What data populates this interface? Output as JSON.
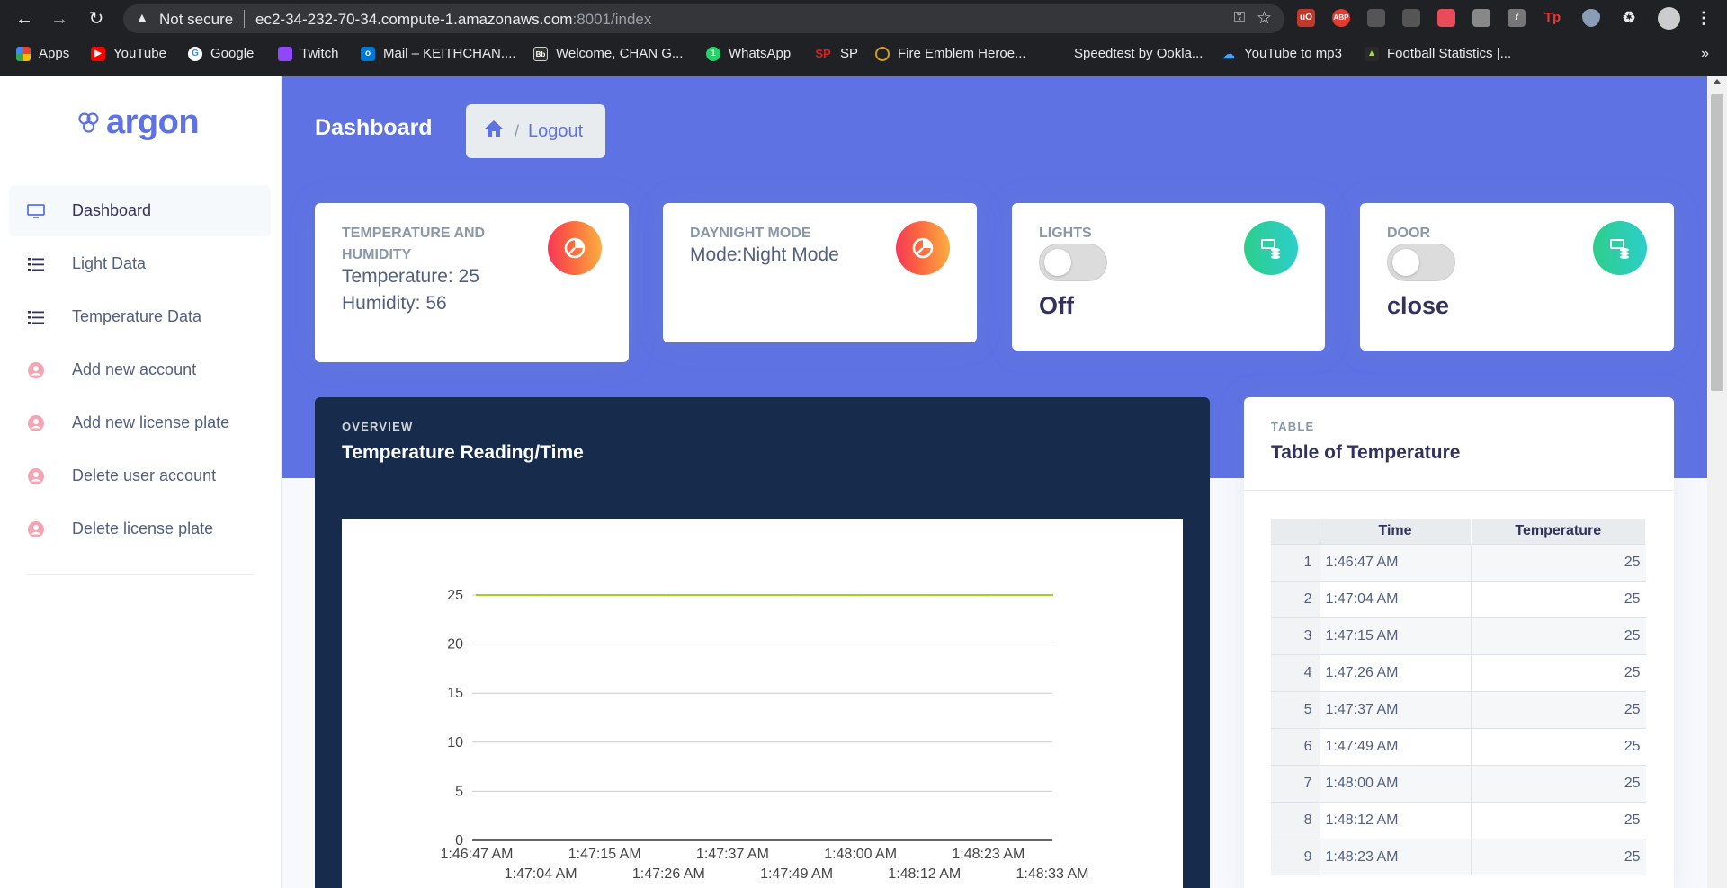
{
  "browser": {
    "security_label": "Not secure",
    "url_host": "ec2-34-232-70-34.compute-1.amazonaws.com",
    "url_path": ":8001/index",
    "bookmarks": [
      {
        "label": "Apps",
        "icon": "apps-grid-icon"
      },
      {
        "label": "YouTube",
        "icon": "youtube-icon"
      },
      {
        "label": "Google",
        "icon": "google-icon"
      },
      {
        "label": "Twitch",
        "icon": "twitch-icon"
      },
      {
        "label": "Mail – KEITHCHAN....",
        "icon": "outlook-icon"
      },
      {
        "label": "Welcome, CHAN G...",
        "icon": "blackboard-icon"
      },
      {
        "label": "WhatsApp",
        "icon": "whatsapp-icon"
      },
      {
        "label": "SP",
        "icon": "sp-icon"
      },
      {
        "label": "Fire Emblem Heroe...",
        "icon": "fire-emblem-icon"
      },
      {
        "label": "Speedtest by Ookla...",
        "icon": "speedtest-icon"
      },
      {
        "label": "YouTube to mp3",
        "icon": "download-cloud-icon"
      },
      {
        "label": "Football Statistics |...",
        "icon": "football-stats-icon"
      }
    ],
    "more_label": "»"
  },
  "brand": {
    "name": "argon"
  },
  "sidebar": {
    "items": [
      {
        "label": "Dashboard",
        "icon": "monitor-icon",
        "active": true
      },
      {
        "label": "Light Data",
        "icon": "list-icon"
      },
      {
        "label": "Temperature Data",
        "icon": "list-icon"
      },
      {
        "label": "Add new account",
        "icon": "user-circle-icon"
      },
      {
        "label": "Add new license plate",
        "icon": "user-circle-icon"
      },
      {
        "label": "Delete user account",
        "icon": "user-circle-icon"
      },
      {
        "label": "Delete license plate",
        "icon": "user-circle-icon"
      }
    ]
  },
  "header": {
    "title": "Dashboard",
    "breadcrumb_sep": "/",
    "breadcrumb_link": "Logout"
  },
  "cards": {
    "temp_humidity": {
      "label": "TEMPERATURE AND HUMIDITY",
      "temperature": "Temperature: 25",
      "humidity": "Humidity: 56",
      "icon": "pie-chart-icon"
    },
    "daynight": {
      "label": "DAYNIGHT MODE",
      "mode": "Mode:Night Mode",
      "icon": "pie-chart-icon"
    },
    "lights": {
      "label": "LIGHTS",
      "state": "Off",
      "toggle_on": false,
      "icon": "money-stack-icon"
    },
    "door": {
      "label": "DOOR",
      "state": "close",
      "toggle_on": false,
      "icon": "money-stack-icon"
    }
  },
  "overview": {
    "subtitle": "OVERVIEW",
    "title": "Temperature Reading/Time"
  },
  "table_card": {
    "subtitle": "TABLE",
    "title": "Table of Temperature",
    "columns": [
      "",
      "Time",
      "Temperature"
    ],
    "rows": [
      [
        "1",
        "1:46:47 AM",
        "25"
      ],
      [
        "2",
        "1:47:04 AM",
        "25"
      ],
      [
        "3",
        "1:47:15 AM",
        "25"
      ],
      [
        "4",
        "1:47:26 AM",
        "25"
      ],
      [
        "5",
        "1:47:37 AM",
        "25"
      ],
      [
        "6",
        "1:47:49 AM",
        "25"
      ],
      [
        "7",
        "1:48:00 AM",
        "25"
      ],
      [
        "8",
        "1:48:12 AM",
        "25"
      ],
      [
        "9",
        "1:48:23 AM",
        "25"
      ]
    ]
  },
  "chart_data": {
    "type": "line",
    "title": "",
    "xlabel": "",
    "ylabel": "",
    "x": [
      "1:46:47 AM",
      "1:47:04 AM",
      "1:47:15 AM",
      "1:47:26 AM",
      "1:47:37 AM",
      "1:47:49 AM",
      "1:48:00 AM",
      "1:48:12 AM",
      "1:48:23 AM",
      "1:48:33 AM"
    ],
    "series": [
      {
        "values": [
          25,
          25,
          25,
          25,
          25,
          25,
          25,
          25,
          25,
          25
        ],
        "color": "#a0d21e"
      }
    ],
    "ylim": [
      0,
      25
    ],
    "yticks": [
      0,
      5,
      10,
      15,
      20,
      25
    ],
    "grid": true,
    "legend": "none"
  }
}
